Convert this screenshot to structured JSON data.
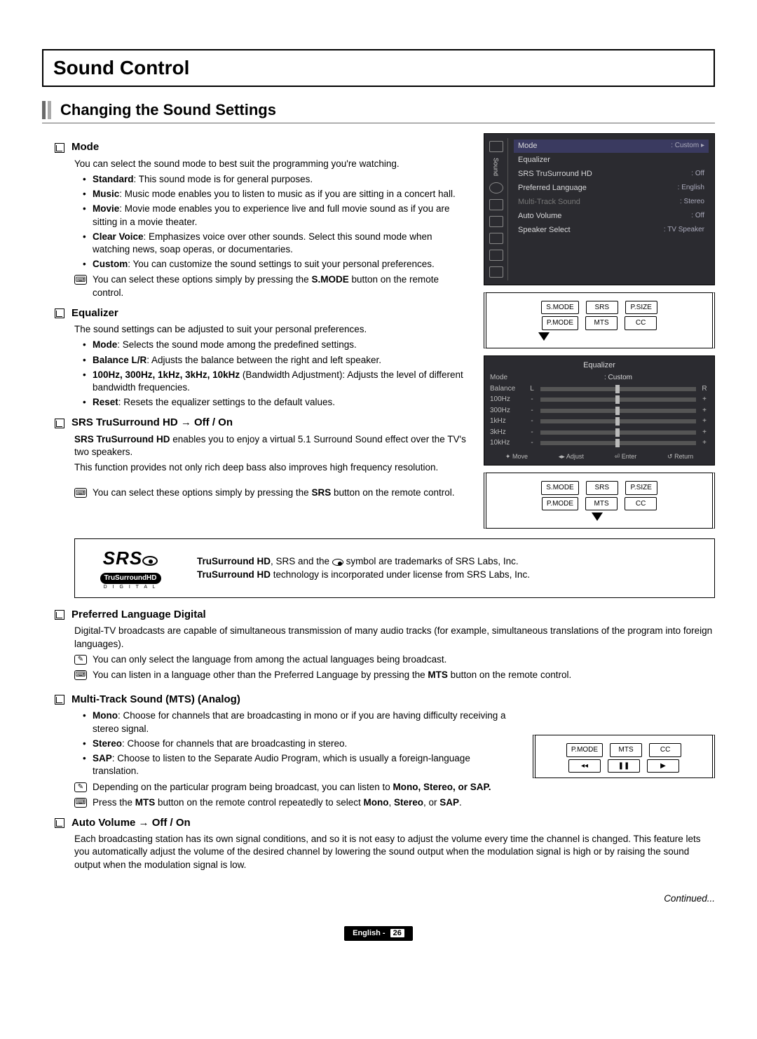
{
  "page": {
    "title": "Sound Control",
    "section": "Changing the Sound Settings",
    "continued": "Continued...",
    "footer_lang": "English -",
    "footer_page": "26"
  },
  "mode": {
    "heading": "Mode",
    "intro": "You can select the sound mode to best suit the programming you're watching.",
    "items": [
      {
        "b": "Standard",
        "t": ": This sound mode is for general purposes."
      },
      {
        "b": "Music",
        "t": ": Music mode enables you to listen to music as if you are sitting in a concert hall."
      },
      {
        "b": "Movie",
        "t": ": Movie mode enables you to experience live and full movie sound as if you are sitting in a movie theater."
      },
      {
        "b": "Clear Voice",
        "t": ": Emphasizes voice over other sounds. Select this sound mode when watching news, soap operas, or documentaries."
      },
      {
        "b": "Custom",
        "t": ": You can customize the sound settings to suit your personal preferences."
      }
    ],
    "note_pre": "You can select these options simply by pressing the ",
    "note_b": "S.MODE",
    "note_post": " button on the remote control."
  },
  "equalizer": {
    "heading": "Equalizer",
    "intro": "The sound settings can be adjusted to suit your personal preferences.",
    "items": [
      {
        "b": "Mode",
        "t": ": Selects the sound mode among the predefined settings."
      },
      {
        "b": "Balance L/R",
        "t": ": Adjusts the balance between the right and left speaker."
      },
      {
        "b": "100Hz, 300Hz, 1kHz, 3kHz, 10kHz",
        "t": " (Bandwidth Adjustment): Adjusts the level of different bandwidth frequencies."
      },
      {
        "b": "Reset",
        "t": ": Resets the equalizer settings to the default values."
      }
    ]
  },
  "srs": {
    "heading": "SRS TruSurround HD → Off / On",
    "p1b": "SRS TruSurround HD",
    "p1t": " enables you to enjoy a virtual 5.1 Surround Sound effect over the TV's two speakers.",
    "p2": "This function provides not only rich deep bass also improves high frequency resolution.",
    "note_pre": "You can select these options simply by pressing the ",
    "note_b": "SRS",
    "note_post": " button on the remote control.",
    "logo_big": "SRS",
    "logo_pill": "TruSurroundHD",
    "logo_tiny": "D I G I T A L",
    "trade1a": "TruSurround HD",
    "trade1b": ", SRS and the ",
    "trade1c": " symbol are trademarks of SRS Labs, Inc.",
    "trade2a": "TruSurround HD",
    "trade2b": " technology is incorporated under license from SRS Labs, Inc."
  },
  "pref_lang": {
    "heading": "Preferred Language Digital",
    "p": "Digital-TV broadcasts are capable of simultaneous transmission of many audio tracks (for example, simultaneous translations of the program into foreign languages).",
    "note1": "You can only select the language from among the actual languages being broadcast.",
    "note2_pre": "You can listen in a language other than the Preferred Language by pressing the ",
    "note2_b": "MTS",
    "note2_post": " button on the remote control."
  },
  "mts": {
    "heading": "Multi-Track Sound (MTS) (Analog)",
    "items": [
      {
        "b": "Mono",
        "t": ": Choose for channels that are broadcasting in mono or if you are having difficulty receiving a stereo signal."
      },
      {
        "b": "Stereo",
        "t": ": Choose for channels that are broadcasting in stereo."
      },
      {
        "b": "SAP",
        "t": ": Choose to listen to the Separate Audio Program, which is usually a foreign-language translation."
      }
    ],
    "note1_pre": "Depending on the particular program being broadcast, you can listen to ",
    "note1_b": "Mono, Stereo, or SAP.",
    "note2_pre": "Press the ",
    "note2_b1": "MTS",
    "note2_mid": " button on the remote control repeatedly to select ",
    "note2_b2": "Mono",
    "note2_b3": "Stereo",
    "note2_b4": "SAP",
    "note2_or": ", or ",
    "note2_comma": ", "
  },
  "auto_vol": {
    "heading": "Auto Volume → Off / On",
    "p": "Each broadcasting station has its own signal conditions, and so it is not easy to adjust the volume every time the channel is changed. This feature lets you automatically adjust the volume of the desired channel by lowering the sound output when the modulation signal is high or by raising the sound output when the modulation signal is low."
  },
  "osd_menu": {
    "side_label": "Sound",
    "rows": [
      {
        "l": "Mode",
        "v": ": Custom ▸",
        "hl": true
      },
      {
        "l": "Equalizer",
        "v": ""
      },
      {
        "l": "SRS TruSurround HD",
        "v": ": Off"
      },
      {
        "l": "Preferred Language",
        "v": ": English"
      },
      {
        "l": "Multi-Track Sound",
        "v": ": Stereo",
        "dim": true
      },
      {
        "l": "Auto Volume",
        "v": ": Off"
      },
      {
        "l": "Speaker Select",
        "v": ": TV Speaker"
      }
    ]
  },
  "remote": {
    "b_smode": "S.MODE",
    "b_srs": "SRS",
    "b_psize": "P.SIZE",
    "b_pmode": "P.MODE",
    "b_mts": "MTS",
    "b_cc": "CC",
    "b_rew": "◂◂",
    "b_pause": "❚❚",
    "b_play": "▶"
  },
  "eq_osd": {
    "title": "Equalizer",
    "mode_l": "Mode",
    "mode_v": ": Custom",
    "rows": [
      "Balance",
      "100Hz",
      "300Hz",
      "1kHz",
      "3kHz",
      "10kHz"
    ],
    "left": "L",
    "right": "R",
    "minus": "-",
    "plus": "+",
    "foot": [
      "✦ Move",
      "◂▸ Adjust",
      "⏎ Enter",
      "↺ Return"
    ]
  }
}
